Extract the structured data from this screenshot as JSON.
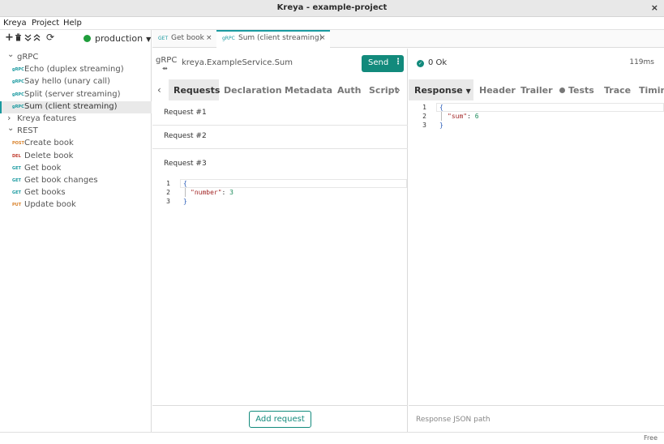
{
  "window": {
    "title": "Kreya - example-project",
    "close_icon": "×"
  },
  "menu": [
    "Kreya",
    "Project",
    "Help"
  ],
  "sidebar": {
    "environment": "production",
    "environment_color": "#1f9d3b",
    "toolbar_icons": [
      "add-icon",
      "delete-icon",
      "collapse-all-icon",
      "expand-all-icon",
      "refresh-icon"
    ],
    "tree": [
      {
        "type": "group",
        "label": "gRPC",
        "expanded": true
      },
      {
        "type": "item",
        "badge": "gRPC",
        "label": "Echo (duplex streaming)"
      },
      {
        "type": "item",
        "badge": "gRPC",
        "label": "Say hello (unary call)"
      },
      {
        "type": "item",
        "badge": "gRPC",
        "label": "Split (server streaming)"
      },
      {
        "type": "item",
        "badge": "gRPC",
        "label": "Sum (client streaming)",
        "selected": true
      },
      {
        "type": "group",
        "label": "Kreya features",
        "expanded": false
      },
      {
        "type": "group",
        "label": "REST",
        "expanded": true
      },
      {
        "type": "item",
        "badge": "POST",
        "label": "Create book"
      },
      {
        "type": "item",
        "badge": "DEL",
        "label": "Delete book"
      },
      {
        "type": "item",
        "badge": "GET",
        "label": "Get book"
      },
      {
        "type": "item",
        "badge": "GET",
        "label": "Get book changes"
      },
      {
        "type": "item",
        "badge": "GET",
        "label": "Get books"
      },
      {
        "type": "item",
        "badge": "PUT",
        "label": "Update book"
      }
    ]
  },
  "badge_colors": {
    "gRPC": "#1a9aa0",
    "POST": "#d9822b",
    "DEL": "#c0392b",
    "GET": "#1a9aa0",
    "PUT": "#d9822b"
  },
  "tabs": [
    {
      "badge": "GET",
      "label": "Get book",
      "active": false
    },
    {
      "badge": "gRPC",
      "label": "Sum (client streaming)",
      "active": true
    }
  ],
  "request": {
    "kind": "gRPC",
    "endpoint": "kreya.ExampleService.Sum",
    "send_label": "Send",
    "subtabs": [
      "Requests",
      "Declaration",
      "Metadata",
      "Auth",
      "Script"
    ],
    "active_subtab": "Requests",
    "requests": [
      "Request #1",
      "Request #2",
      "Request #3"
    ],
    "body_lines": [
      "{",
      "  \"number\": 3",
      "}"
    ],
    "body_key": "\"number\"",
    "body_value": "3",
    "add_request_label": "Add request"
  },
  "response": {
    "status": "0 Ok",
    "duration": "119ms",
    "tabs": [
      "Response",
      "Header",
      "Trailer",
      "Tests",
      "Trace",
      "Timing"
    ],
    "active_tab": "Response",
    "body_key": "\"sum\"",
    "body_value": "6",
    "json_path_placeholder": "Response JSON path"
  },
  "statusbar": {
    "license": "Free"
  }
}
